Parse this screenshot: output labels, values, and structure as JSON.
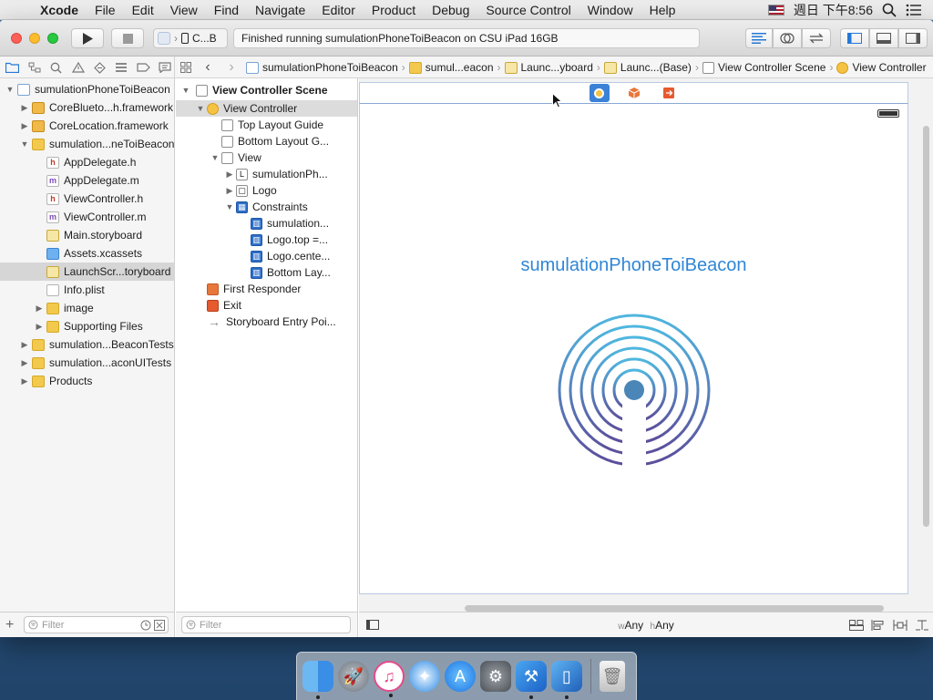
{
  "menubar": {
    "app": "Xcode",
    "items": [
      "File",
      "Edit",
      "View",
      "Find",
      "Navigate",
      "Editor",
      "Product",
      "Debug",
      "Source Control",
      "Window",
      "Help"
    ],
    "clock": "週日 下午8:56"
  },
  "toolbar": {
    "scheme": "C...B",
    "status": "Finished running sumulationPhoneToiBeacon on CSU iPad 16GB"
  },
  "jumpbar": [
    "sumulationPhoneToiBeacon",
    "sumul...eacon",
    "Launc...yboard",
    "Launc...(Base)",
    "View Controller Scene",
    "View Controller"
  ],
  "navigator": {
    "rows": [
      {
        "label": "sumulationPhoneToiBeacon",
        "depth": 0,
        "icon": "project",
        "disclosure": "open"
      },
      {
        "label": "CoreBlueto...h.framework",
        "depth": 1,
        "icon": "framework",
        "disclosure": "closed"
      },
      {
        "label": "CoreLocation.framework",
        "depth": 1,
        "icon": "framework",
        "disclosure": "closed"
      },
      {
        "label": "sumulation...neToiBeacon",
        "depth": 1,
        "icon": "folder",
        "disclosure": "open"
      },
      {
        "label": "AppDelegate.h",
        "depth": 2,
        "icon": "h",
        "disclosure": ""
      },
      {
        "label": "AppDelegate.m",
        "depth": 2,
        "icon": "m",
        "disclosure": ""
      },
      {
        "label": "ViewController.h",
        "depth": 2,
        "icon": "h",
        "disclosure": ""
      },
      {
        "label": "ViewController.m",
        "depth": 2,
        "icon": "m",
        "disclosure": ""
      },
      {
        "label": "Main.storyboard",
        "depth": 2,
        "icon": "storyboard",
        "disclosure": ""
      },
      {
        "label": "Assets.xcassets",
        "depth": 2,
        "icon": "xcassets",
        "disclosure": ""
      },
      {
        "label": "LaunchScr...toryboard",
        "depth": 2,
        "icon": "storyboard",
        "disclosure": "",
        "selected": true
      },
      {
        "label": "Info.plist",
        "depth": 2,
        "icon": "plist",
        "disclosure": ""
      },
      {
        "label": "image",
        "depth": 2,
        "icon": "folder",
        "disclosure": "closed"
      },
      {
        "label": "Supporting Files",
        "depth": 2,
        "icon": "folder",
        "disclosure": "closed"
      },
      {
        "label": "sumulation...BeaconTests",
        "depth": 1,
        "icon": "folder",
        "disclosure": "closed"
      },
      {
        "label": "sumulation...aconUITests",
        "depth": 1,
        "icon": "folder",
        "disclosure": "closed"
      },
      {
        "label": "Products",
        "depth": 1,
        "icon": "folder",
        "disclosure": "closed"
      }
    ],
    "filter_placeholder": "Filter"
  },
  "outline": {
    "scene_title": "View Controller Scene",
    "rows": [
      {
        "label": "View Controller",
        "depth": 1,
        "icon": "vc",
        "disclosure": "open",
        "selected": true
      },
      {
        "label": "Top Layout Guide",
        "depth": 2,
        "icon": "rect",
        "disclosure": ""
      },
      {
        "label": "Bottom Layout G...",
        "depth": 2,
        "icon": "rect",
        "disclosure": ""
      },
      {
        "label": "View",
        "depth": 2,
        "icon": "rect",
        "disclosure": "open"
      },
      {
        "label": "sumulationPh...",
        "depth": 3,
        "icon": "label",
        "disclosure": "closed"
      },
      {
        "label": "Logo",
        "depth": 3,
        "icon": "image",
        "disclosure": "closed"
      },
      {
        "label": "Constraints",
        "depth": 3,
        "icon": "constraints",
        "disclosure": "open"
      },
      {
        "label": "sumulation...",
        "depth": 4,
        "icon": "constraint",
        "disclosure": ""
      },
      {
        "label": "Logo.top =...",
        "depth": 4,
        "icon": "constraint",
        "disclosure": ""
      },
      {
        "label": "Logo.cente...",
        "depth": 4,
        "icon": "constraint",
        "disclosure": ""
      },
      {
        "label": "Bottom Lay...",
        "depth": 4,
        "icon": "constraint",
        "disclosure": ""
      },
      {
        "label": "First Responder",
        "depth": 1,
        "icon": "responder",
        "disclosure": ""
      },
      {
        "label": "Exit",
        "depth": 1,
        "icon": "exit",
        "disclosure": ""
      },
      {
        "label": "Storyboard Entry Poi...",
        "depth": 1,
        "icon": "arrow",
        "disclosure": ""
      }
    ],
    "filter_placeholder": "Filter"
  },
  "canvas": {
    "app_title": "sumulationPhoneToiBeacon",
    "size_class_w_prefix": "w",
    "size_class_w": "Any",
    "size_class_h_prefix": "h",
    "size_class_h": "Any",
    "accent": "#2f86d6"
  }
}
